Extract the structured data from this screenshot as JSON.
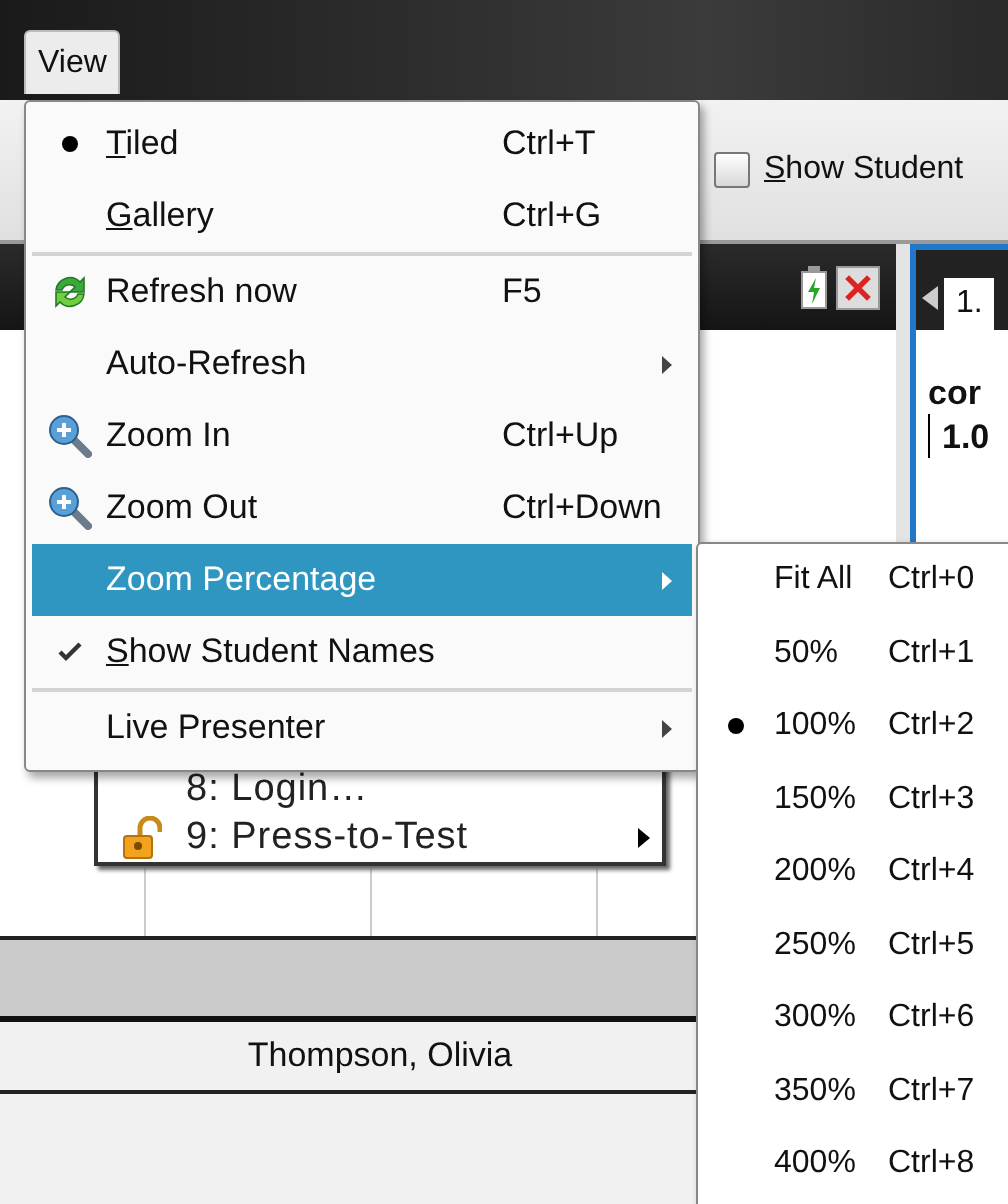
{
  "menubar": {
    "label": "View"
  },
  "toolbar": {
    "checkbox": {
      "label": "Show Student",
      "checked": false
    }
  },
  "document_menu": {
    "items": [
      {
        "kind": "plain",
        "label": "8: Login…",
        "submenu": false
      },
      {
        "kind": "locked",
        "label": "9: Press-to-Test",
        "submenu": true
      }
    ]
  },
  "student_row": {
    "name": "Thompson, Olivia"
  },
  "right_panel": {
    "tab": "1.",
    "heading": "cor",
    "value": "1.0"
  },
  "view_menu": {
    "items": [
      {
        "kind": "radio",
        "label": "Tiled",
        "shortcut": "Ctrl+T",
        "checked": true,
        "selected": false,
        "mnemonic": true,
        "separator_after": false
      },
      {
        "kind": "radio",
        "label": "Gallery",
        "shortcut": "Ctrl+G",
        "checked": false,
        "selected": false,
        "mnemonic": true,
        "separator_after": true
      },
      {
        "kind": "refresh",
        "label": "Refresh now",
        "shortcut": "F5",
        "selected": false,
        "mnemonic": false,
        "separator_after": false
      },
      {
        "kind": "submenu",
        "label": "Auto-Refresh",
        "selected": false,
        "mnemonic": false,
        "separator_after": false
      },
      {
        "kind": "zoom-in",
        "label": "Zoom In",
        "shortcut": "Ctrl+Up",
        "selected": false,
        "mnemonic": false,
        "separator_after": false
      },
      {
        "kind": "zoom-out",
        "label": "Zoom Out",
        "shortcut": "Ctrl+Down",
        "selected": false,
        "mnemonic": false,
        "separator_after": false
      },
      {
        "kind": "submenu",
        "label": "Zoom Percentage",
        "selected": true,
        "mnemonic": false,
        "separator_after": false
      },
      {
        "kind": "check",
        "label": "Show Student Names",
        "checked": true,
        "selected": false,
        "mnemonic": true,
        "separator_after": true
      },
      {
        "kind": "submenu",
        "label": "Live Presenter",
        "selected": false,
        "mnemonic": false,
        "separator_after": false
      }
    ]
  },
  "zoom_submenu": {
    "items": [
      {
        "label": "Fit All",
        "shortcut": "Ctrl+0",
        "checked": false
      },
      {
        "label": "50%",
        "shortcut": "Ctrl+1",
        "checked": false
      },
      {
        "label": "100%",
        "shortcut": "Ctrl+2",
        "checked": true
      },
      {
        "label": "150%",
        "shortcut": "Ctrl+3",
        "checked": false
      },
      {
        "label": "200%",
        "shortcut": "Ctrl+4",
        "checked": false
      },
      {
        "label": "250%",
        "shortcut": "Ctrl+5",
        "checked": false
      },
      {
        "label": "300%",
        "shortcut": "Ctrl+6",
        "checked": false
      },
      {
        "label": "350%",
        "shortcut": "Ctrl+7",
        "checked": false
      },
      {
        "label": "400%",
        "shortcut": "Ctrl+8",
        "checked": false
      }
    ]
  }
}
